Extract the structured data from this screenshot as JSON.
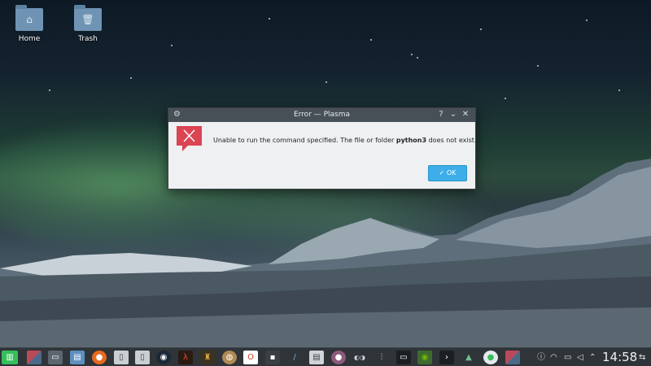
{
  "desktop": {
    "icons": [
      {
        "label": "Home",
        "glyph": "⌂",
        "icon": "home-folder-icon"
      },
      {
        "label": "Trash",
        "glyph": "🗑",
        "icon": "trash-folder-icon"
      }
    ]
  },
  "dialog": {
    "title": "Error — Plasma",
    "help_label": "?",
    "minimize_label": "⌄",
    "close_label": "✕",
    "message_prefix": "Unable to run the command specified. The file or folder ",
    "message_bold": "python3",
    "message_suffix": " does not exist.",
    "ok_check": "✓",
    "ok_label": "OK",
    "error_icon_color": "#da4453"
  },
  "taskbar": {
    "clock": "14:58",
    "colors": {
      "background": "#2f3438",
      "accent": "#3daee9"
    }
  }
}
